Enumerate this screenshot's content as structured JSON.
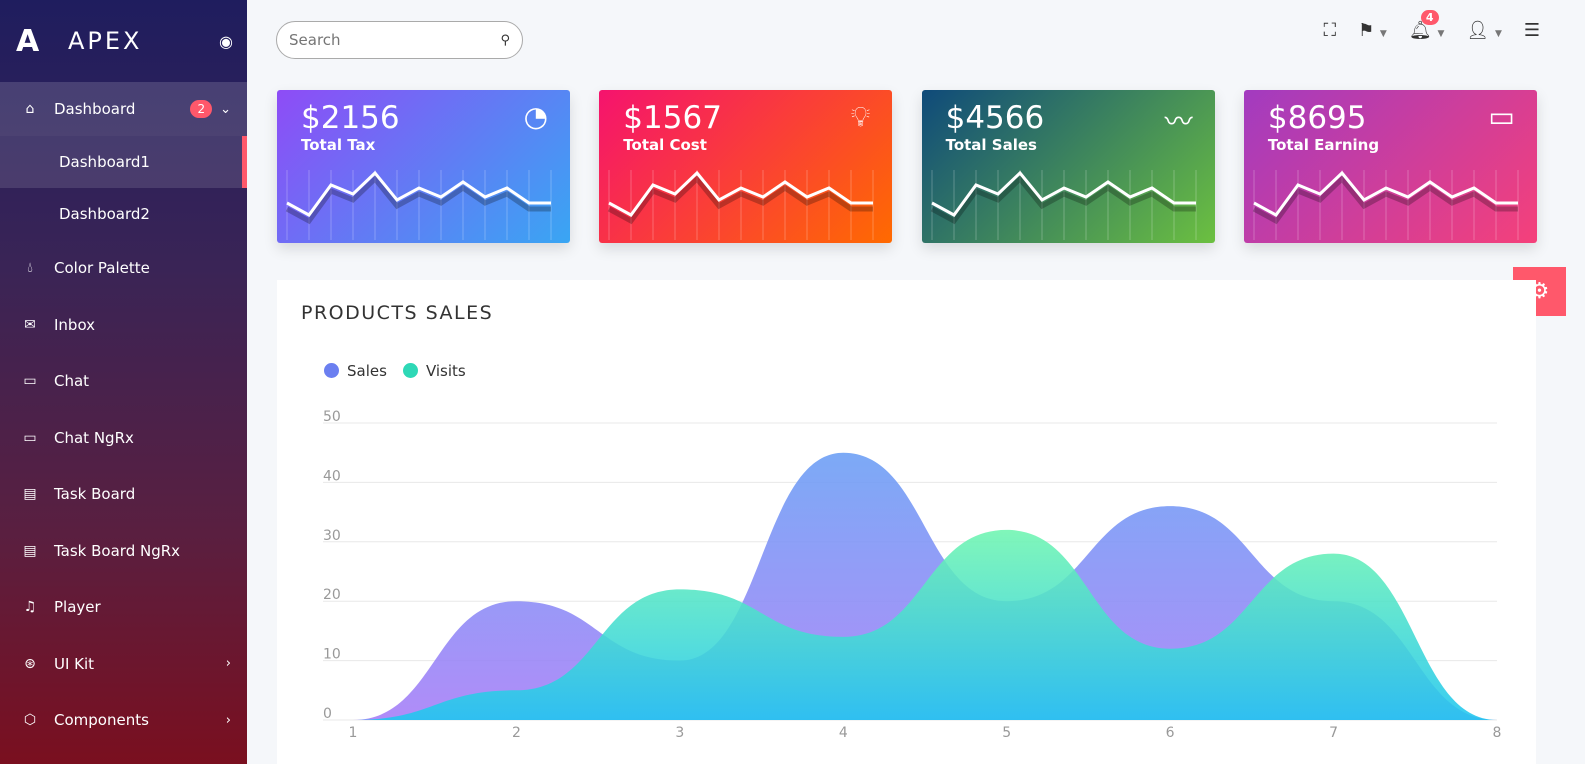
{
  "sidebar": {
    "brand": "APEX",
    "items": [
      {
        "label": "Dashboard",
        "icon": "home-icon",
        "badge": "2"
      },
      {
        "label": "Color Palette",
        "icon": "droplet-icon"
      },
      {
        "label": "Inbox",
        "icon": "mail-icon"
      },
      {
        "label": "Chat",
        "icon": "chat-icon"
      },
      {
        "label": "Chat NgRx",
        "icon": "chat-icon"
      },
      {
        "label": "Task Board",
        "icon": "file-icon"
      },
      {
        "label": "Task Board NgRx",
        "icon": "file-icon"
      },
      {
        "label": "Player",
        "icon": "music-icon"
      },
      {
        "label": "UI Kit",
        "icon": "aperture-icon"
      },
      {
        "label": "Components",
        "icon": "box-icon"
      }
    ],
    "subitems": [
      {
        "label": "Dashboard1"
      },
      {
        "label": "Dashboard2"
      }
    ]
  },
  "header": {
    "search_placeholder": "Search",
    "notifications": "4"
  },
  "cards": [
    {
      "value": "$2156",
      "label": "Total Tax",
      "icon": "pie-chart-icon"
    },
    {
      "value": "$1567",
      "label": "Total Cost",
      "icon": "lightbulb-icon"
    },
    {
      "value": "$4566",
      "label": "Total Sales",
      "icon": "trending-up-icon"
    },
    {
      "value": "$8695",
      "label": "Total Earning",
      "icon": "wallet-icon"
    }
  ],
  "chart_data": {
    "type": "area",
    "title": "PRODUCTS SALES",
    "x": [
      1,
      2,
      3,
      4,
      5,
      6,
      7,
      8
    ],
    "series": [
      {
        "name": "Sales",
        "values": [
          0,
          20,
          10,
          45,
          20,
          36,
          20,
          0
        ],
        "color": "#7b6cf6"
      },
      {
        "name": "Visits",
        "values": [
          0,
          5,
          22,
          14,
          32,
          12,
          28,
          0
        ],
        "color": "#2ed8b6"
      }
    ],
    "ylim": [
      0,
      50
    ],
    "yticks": [
      0,
      10,
      20,
      30,
      40,
      50
    ],
    "grid": true,
    "legend": "top-left"
  }
}
